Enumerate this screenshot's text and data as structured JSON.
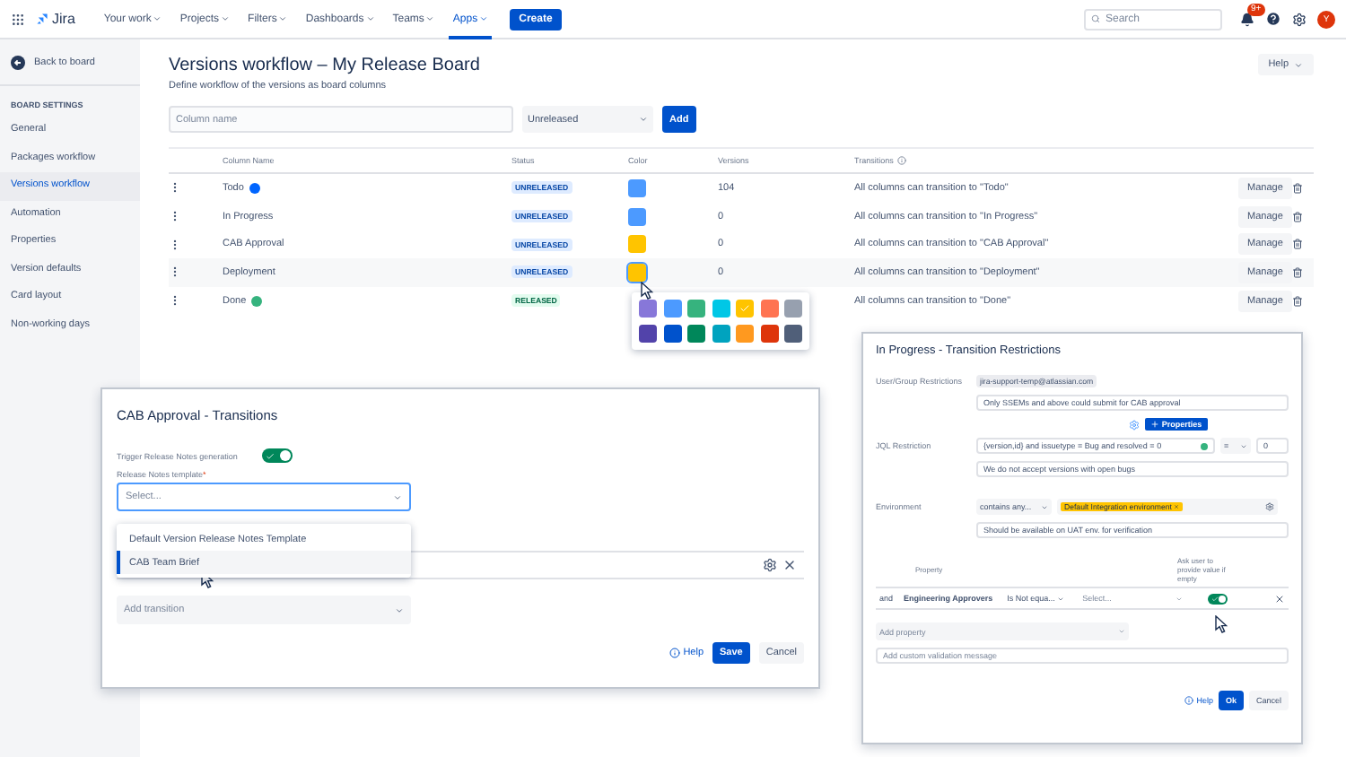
{
  "nav": {
    "menu": [
      {
        "label": "Your work",
        "selected": false
      },
      {
        "label": "Projects",
        "selected": false
      },
      {
        "label": "Filters",
        "selected": false
      },
      {
        "label": "Dashboards",
        "selected": false
      },
      {
        "label": "Teams",
        "selected": false
      },
      {
        "label": "Apps",
        "selected": true
      }
    ],
    "logo": "Jira",
    "create": "Create",
    "search_placeholder": "Search",
    "notification_count": "9+",
    "avatar": "Y"
  },
  "sidebar": {
    "back": "Back to board",
    "heading": "BOARD SETTINGS",
    "items": [
      {
        "label": "General",
        "selected": false
      },
      {
        "label": "Packages workflow",
        "selected": false
      },
      {
        "label": "Versions workflow",
        "selected": true
      },
      {
        "label": "Automation",
        "selected": false
      },
      {
        "label": "Properties",
        "selected": false
      },
      {
        "label": "Version defaults",
        "selected": false
      },
      {
        "label": "Card layout",
        "selected": false
      },
      {
        "label": "Non-working days",
        "selected": false
      }
    ]
  },
  "page": {
    "title": "Versions workflow – My Release Board",
    "subtitle": "Define workflow of the versions as board columns",
    "help": "Help",
    "column_name_placeholder": "Column name",
    "status_select": "Unreleased",
    "add": "Add"
  },
  "table": {
    "columns": [
      "Column Name",
      "Status",
      "Color",
      "Versions",
      "Transitions"
    ],
    "rows": [
      {
        "name": "Todo",
        "badge": {
          "color": "#0065ff"
        },
        "status": {
          "text": "UNRELEASED",
          "kind": "unreleased"
        },
        "color": "#4c9aff",
        "versions": "104",
        "transition": "All columns can transition to \"Todo\"",
        "manage": "Manage",
        "hovered": false
      },
      {
        "name": "In Progress",
        "status": {
          "text": "UNRELEASED",
          "kind": "unreleased"
        },
        "color": "#4c9aff",
        "versions": "0",
        "transition": "All columns can transition to \"In Progress\"",
        "manage": "Manage",
        "hovered": false
      },
      {
        "name": "CAB Approval",
        "status": {
          "text": "UNRELEASED",
          "kind": "unreleased"
        },
        "color": "#ffc400",
        "versions": "0",
        "transition": "All columns can transition to \"CAB Approval\"",
        "manage": "Manage",
        "hovered": false
      },
      {
        "name": "Deployment",
        "status": {
          "text": "UNRELEASED",
          "kind": "unreleased"
        },
        "color": "#ffc400",
        "versions": "0",
        "transition": "All columns can transition to \"Deployment\"",
        "manage": "Manage",
        "hovered": true
      },
      {
        "name": "Done",
        "badge": {
          "color": "#36b37e"
        },
        "status": {
          "text": "RELEASED",
          "kind": "released"
        },
        "transition": "All columns can transition to \"Done\"",
        "manage": "Manage"
      }
    ]
  },
  "color_picker": {
    "swatches": [
      {
        "color": "#8777d9",
        "selected": false
      },
      {
        "color": "#4c9aff",
        "selected": false
      },
      {
        "color": "#36b37e",
        "selected": false
      },
      {
        "color": "#00c7e6",
        "selected": false
      },
      {
        "color": "#ffc400",
        "selected": true
      },
      {
        "color": "#ff7452",
        "selected": false
      },
      {
        "color": "#97a0af",
        "selected": false
      },
      {
        "color": "#5243aa",
        "selected": false
      },
      {
        "color": "#0052cc",
        "selected": false
      },
      {
        "color": "#00875a",
        "selected": false
      },
      {
        "color": "#00a3bf",
        "selected": false
      },
      {
        "color": "#ff991f",
        "selected": false
      },
      {
        "color": "#de350b",
        "selected": false
      },
      {
        "color": "#505f79",
        "selected": false
      }
    ]
  },
  "transitions_dialog": {
    "title": "CAB Approval - Transitions",
    "toggle_label": "Trigger Release Notes generation",
    "toggle_on": true,
    "template_label": "Release Notes template",
    "required_mark": "*",
    "template_placeholder": "Select...",
    "options": [
      {
        "label": "Default Version Release Notes Template",
        "selected": false
      },
      {
        "label": "CAB Team Brief",
        "selected": true
      }
    ],
    "add_transition": "Add transition",
    "help": "Help",
    "save": "Save",
    "cancel": "Cancel"
  },
  "restrictions_dialog": {
    "title": "In Progress - Transition Restrictions",
    "user_group": {
      "label": "User/Group Restrictions",
      "chip": "jira-support-temp@atlassian.com",
      "message": "Only SSEMs and above could submit for CAB approval"
    },
    "properties_button": "Properties",
    "jql": {
      "label": "JQL Restriction",
      "query": "{version,id} and issuetype = Bug and resolved = 0",
      "valid": true,
      "operator": "=",
      "value": "0",
      "message": "We do not accept versions with open bugs"
    },
    "environment": {
      "label": "Environment",
      "operator": "contains any...",
      "tag": "Default Integration environment",
      "message": "Should be available on UAT env. for verification"
    },
    "property_header": "Property",
    "ask_header": "Ask user to provide value if empty",
    "property_row": {
      "conjunction": "and",
      "name": "Engineering Approvers",
      "operator": "Is Not equa...",
      "value_placeholder": "Select...",
      "ask_on": true
    },
    "add_property": "Add property",
    "custom_message_placeholder": "Add custom validation message",
    "help": "Help",
    "ok": "Ok",
    "cancel": "Cancel"
  }
}
